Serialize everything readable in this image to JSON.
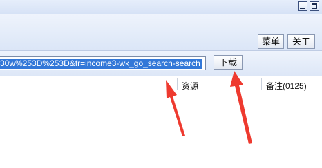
{
  "toolbar": {
    "menu_label": "菜单",
    "about_label": "关于"
  },
  "address": {
    "visible_text": "30w%253D%253D&fr=income3-wk_go_search-search"
  },
  "download": {
    "label": "下载"
  },
  "columns": {
    "resource": "资源",
    "note": "备注(0125)"
  },
  "annotations": {
    "arrow_color": "#ee3a2f"
  }
}
